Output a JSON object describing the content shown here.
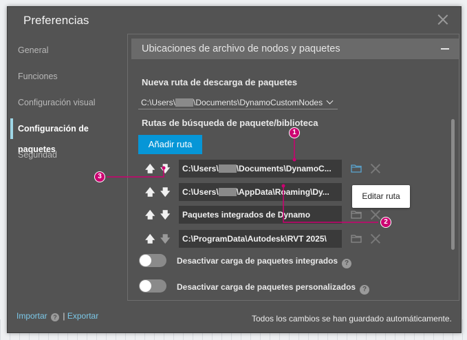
{
  "window": {
    "title": "Preferencias"
  },
  "nav": {
    "items": [
      {
        "label": "General",
        "active": false
      },
      {
        "label": "Funciones",
        "active": false
      },
      {
        "label": "Configuración visual",
        "active": false
      },
      {
        "label": "Configuración de paquetes",
        "active": true
      },
      {
        "label": "Seguridad",
        "active": false
      }
    ]
  },
  "section": {
    "title": "Ubicaciones de archivo de nodos y paquetes",
    "download_label": "Nueva ruta de descarga de paquetes",
    "download_path_prefix": "C:\\Users\\",
    "download_path_suffix": "\\Documents\\DynamoCustomNodes",
    "search_label": "Rutas de búsqueda de paquete/biblioteca",
    "add_button": "Añadir ruta",
    "paths": [
      {
        "prefix": "C:\\Users\\",
        "suffix": "\\Documents\\DynamoC...",
        "masked": true
      },
      {
        "prefix": "C:\\Users\\",
        "suffix": "\\AppData\\Roaming\\Dy...",
        "masked": true
      },
      {
        "prefix": "Paquetes integrados de Dynamo",
        "suffix": "",
        "masked": false
      },
      {
        "prefix": "C:\\ProgramData\\Autodesk\\RVT 2025\\",
        "suffix": "",
        "masked": false
      }
    ],
    "tooltip": "Editar ruta",
    "toggles": [
      {
        "label": "Desactivar carga de paquetes integrados",
        "on": false
      },
      {
        "label": "Desactivar carga de paquetes personalizados",
        "on": false
      }
    ]
  },
  "footer": {
    "import": "Importar",
    "separator": "|",
    "export": "Exportar",
    "status": "Todos los cambios se han guardado automáticamente."
  },
  "callouts": [
    "1",
    "2",
    "3"
  ],
  "colors": {
    "accent": "#0696d7",
    "callout": "#cc0071",
    "active_marker": "#9fd6e6"
  }
}
